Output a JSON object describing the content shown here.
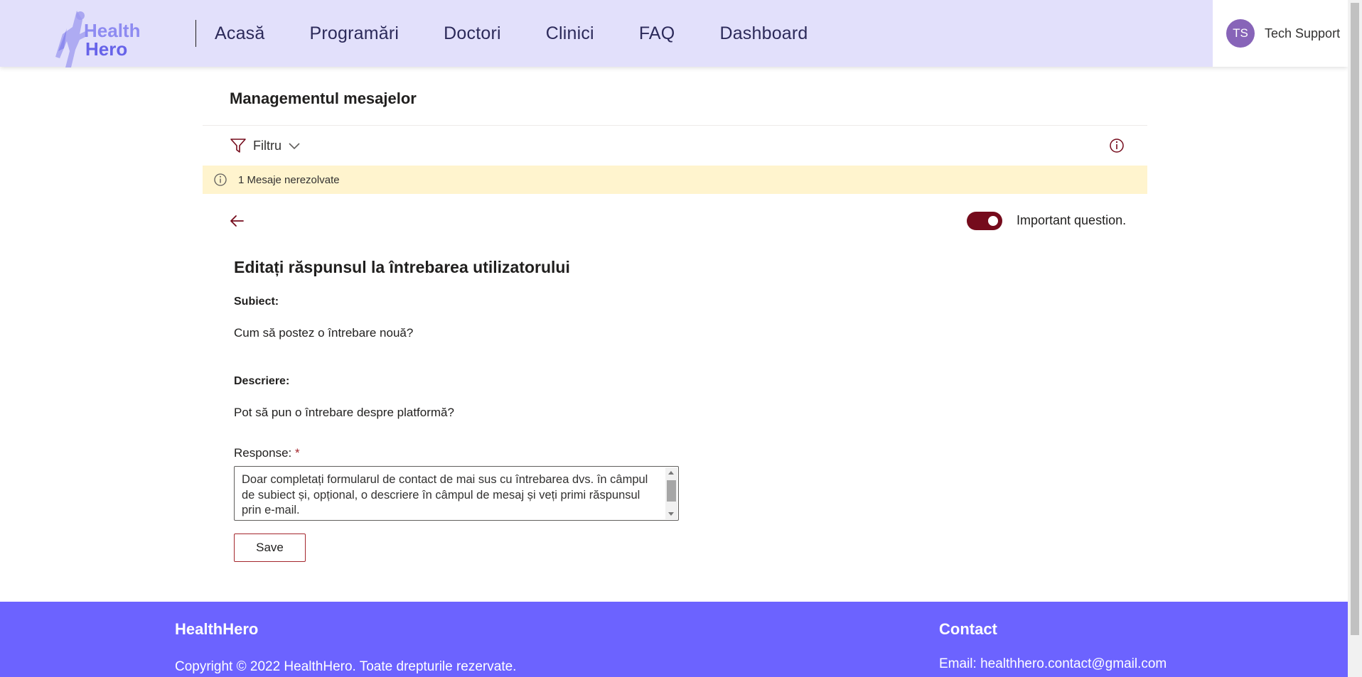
{
  "header": {
    "logo_line1": "Health",
    "logo_line2": "Hero",
    "nav": [
      "Acasă",
      "Programări",
      "Doctori",
      "Clinici",
      "FAQ",
      "Dashboard"
    ],
    "user_initials": "TS",
    "user_name": "Tech Support"
  },
  "main": {
    "title": "Managementul mesajelor",
    "filter_label": "Filtru",
    "alert_text": "1 Mesaje nerezolvate",
    "toggle_label": "Important question.",
    "toggle_on": true,
    "edit_title": "Editați răspunsul la întrebarea utilizatorului",
    "subject_label": "Subiect:",
    "subject_value": "Cum să postez o întrebare nouă?",
    "description_label": "Descriere:",
    "description_value": "Pot să pun o întrebare despre platformă?",
    "response_label": "Response:",
    "required_marker": "*",
    "response_value": "Doar completați formularul de contact de mai sus cu întrebarea dvs. în câmpul de subiect și, opțional, o descriere în câmpul de mesaj și veți primi răspunsul prin e-mail.",
    "save_label": "Save"
  },
  "footer": {
    "brand": "HealthHero",
    "copyright": "Copyright © 2022 HealthHero. Toate drepturile rezervate.",
    "contact_title": "Contact",
    "email": "Email: healthhero.contact@gmail.com"
  },
  "colors": {
    "header_bg": "#e2e0fb",
    "accent": "#750b1c",
    "footer_bg": "#6c63ff",
    "alert_bg": "#fff4ce",
    "avatar_bg": "#8764b8"
  }
}
